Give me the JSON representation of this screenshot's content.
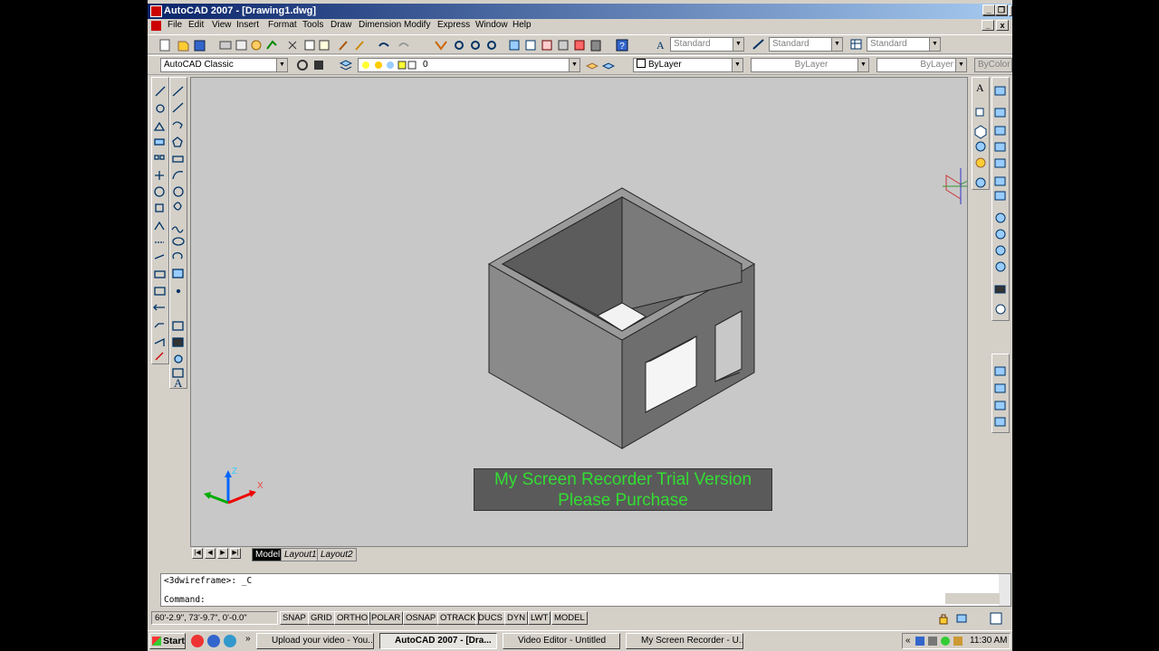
{
  "window": {
    "title": "AutoCAD 2007 - [Drawing1.dwg]"
  },
  "menu": [
    "File",
    "Edit",
    "View",
    "Insert",
    "Format",
    "Tools",
    "Draw",
    "Dimension",
    "Modify",
    "Express",
    "Window",
    "Help"
  ],
  "styles_toolbar": {
    "text_style": "Standard",
    "dim_style": "Standard",
    "table_style": "Standard"
  },
  "workspace": {
    "value": "AutoCAD Classic"
  },
  "layers": {
    "current_layer": "0"
  },
  "properties": {
    "color": "ByLayer",
    "linetype": "ByLayer",
    "lineweight": "ByLayer",
    "plotstyle": "ByColor"
  },
  "watermark": {
    "line1": "My Screen Recorder Trial Version",
    "line2": "Please Purchase"
  },
  "ucs": {
    "z": "Z",
    "x": "X"
  },
  "layout_tabs": [
    "Model",
    "Layout1",
    "Layout2"
  ],
  "command": {
    "history": "<3dwireframe>: _C",
    "prompt": "Command:"
  },
  "status": {
    "coords": "60'-2.9\", 73'-9.7\", 0'-0.0\"",
    "toggles": [
      "SNAP",
      "GRID",
      "ORTHO",
      "POLAR",
      "OSNAP",
      "OTRACK",
      "DUCS",
      "DYN",
      "LWT",
      "MODEL"
    ]
  },
  "taskbar": {
    "start": "Start",
    "tasks": [
      "Upload your video - You...",
      "AutoCAD 2007 - [Dra...",
      "Video Editor - Untitled",
      "My Screen Recorder - U..."
    ],
    "clock": "11:30 AM"
  },
  "colors": {
    "title_start": "#0a246a",
    "title_end": "#a6caf0",
    "canvas": "#c8c8c8",
    "watermark_text": "#33dd33"
  }
}
